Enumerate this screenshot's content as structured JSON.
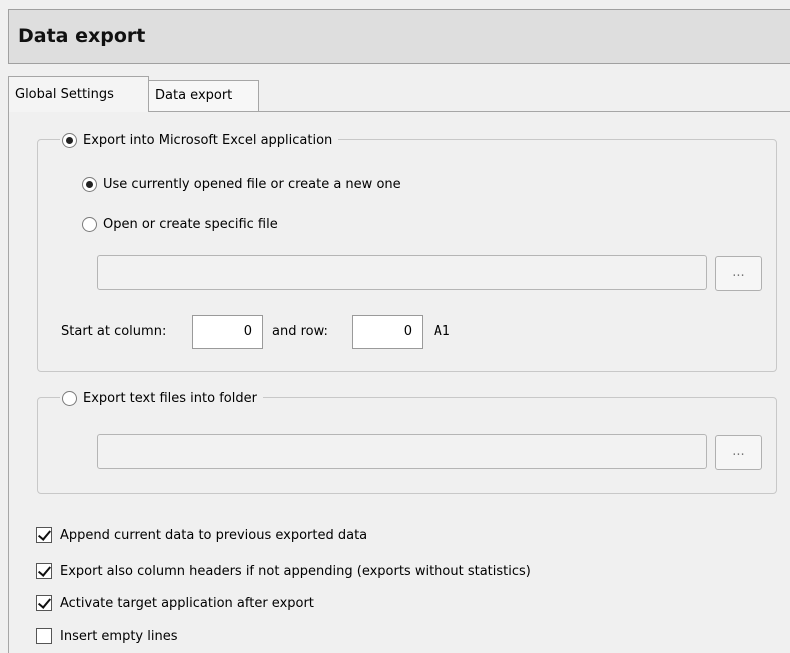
{
  "title": "Data export",
  "tabs": [
    {
      "label": "Global Settings",
      "active": true
    },
    {
      "label": "Data export",
      "active": false
    }
  ],
  "excel_group": {
    "label": "Export into Microsoft Excel application",
    "selected": true,
    "options": [
      {
        "label": "Use currently opened file or create a new one",
        "selected": true
      },
      {
        "label": "Open or create specific file",
        "selected": false
      }
    ],
    "file_path": "",
    "browse_label": "...",
    "start_column_label": "Start at column:",
    "start_column_value": "0",
    "row_label": "and row:",
    "row_value": "0",
    "cell_ref": "A1"
  },
  "text_group": {
    "label": "Export text files into folder",
    "selected": false,
    "folder_path": "",
    "browse_label": "..."
  },
  "options": [
    {
      "label": "Append current data to previous exported data",
      "checked": true
    },
    {
      "label": "Export also column headers if not appending (exports without statistics)",
      "checked": true
    },
    {
      "label": "Activate target application after export",
      "checked": true
    },
    {
      "label": "Insert empty lines",
      "checked": false
    }
  ]
}
